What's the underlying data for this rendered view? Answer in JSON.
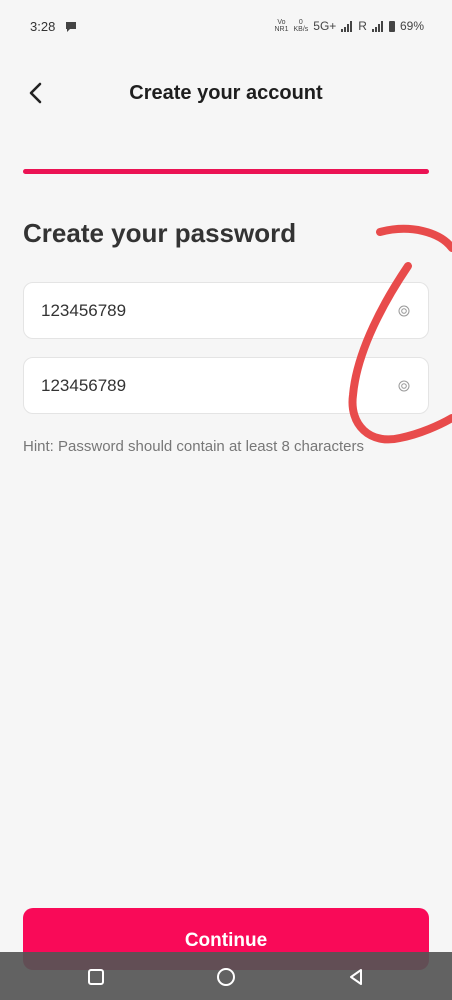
{
  "status_bar": {
    "time": "3:28",
    "vo_top": "Vo",
    "vo_bottom": "NR1",
    "speed_top": "0",
    "speed_bottom": "KB/s",
    "network": "5G+",
    "roaming": "R",
    "battery": "69%"
  },
  "header": {
    "title": "Create your account"
  },
  "progress": {
    "value": 1.0,
    "color": "#eb1354"
  },
  "form": {
    "heading": "Create your password",
    "password_value": "123456789",
    "confirm_value": "123456789",
    "hint": "Hint: Password should contain at least 8 characters"
  },
  "footer": {
    "continue_label": "Continue"
  },
  "icons": {
    "back": "chevron-left-icon",
    "eye": "eye-icon",
    "nav_recent": "square-icon",
    "nav_home": "circle-icon",
    "nav_back": "triangle-icon"
  },
  "colors": {
    "accent": "#f90a58",
    "annotation": "#e84b4b"
  }
}
